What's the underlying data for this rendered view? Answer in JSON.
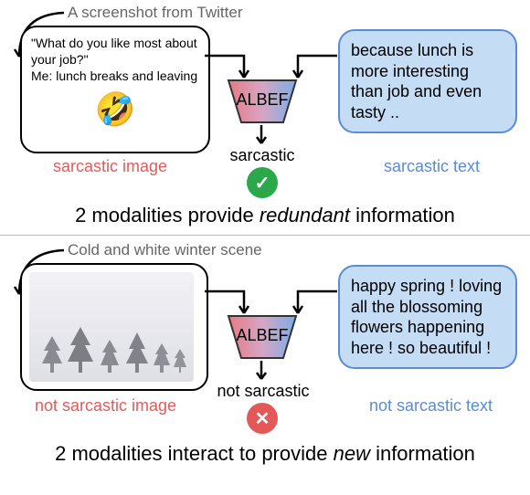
{
  "top": {
    "annotation": "A screenshot from Twitter",
    "image_quote": "\"What do you like most about your job?\"\nMe: lunch breaks and leaving",
    "emoji": "🤣",
    "model_label": "ALBEF",
    "text_content": "because lunch is more interesting than job and even tasty ..",
    "image_label": "sarcastic image",
    "text_label": "sarcastic text",
    "output_label": "sarcastic",
    "result_icon": "check",
    "caption_pre": "2 modalities provide ",
    "caption_em": "redundant",
    "caption_post": " information"
  },
  "bottom": {
    "annotation": "Cold and white winter scene",
    "model_label": "ALBEF",
    "text_content": "happy spring ! loving all the blossoming flowers happening here ! so beautiful !",
    "image_label": "not sarcastic image",
    "text_label": "not sarcastic text",
    "output_label": "not sarcastic",
    "result_icon": "cross",
    "caption_pre": "2 modalities interact to provide ",
    "caption_em": "new",
    "caption_post": " information"
  }
}
